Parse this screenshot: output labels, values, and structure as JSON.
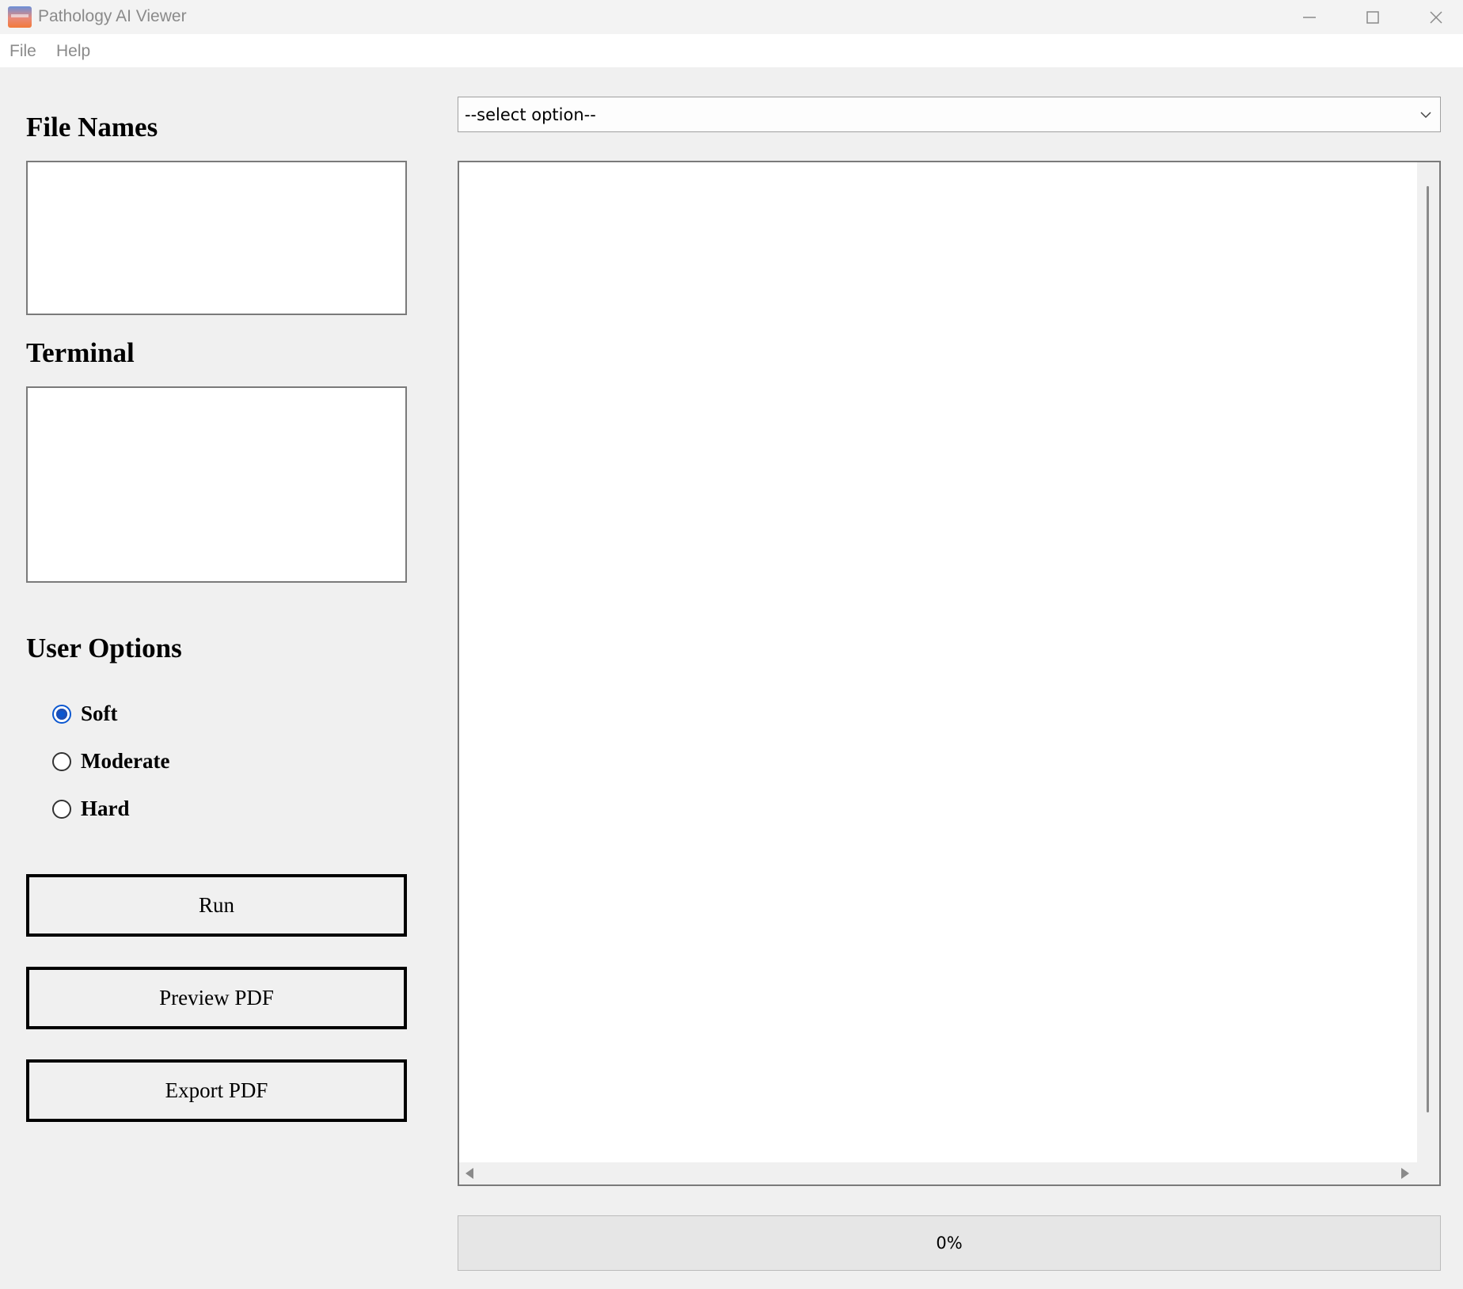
{
  "window": {
    "title": "Pathology AI Viewer",
    "icon": "app-logo-icon",
    "controls": [
      "minimize-icon",
      "maximize-icon",
      "close-icon"
    ]
  },
  "menu": {
    "file": "File",
    "help": "Help"
  },
  "left_panel": {
    "file_names_heading": "File Names",
    "terminal_heading": "Terminal",
    "user_options_heading": "User Options",
    "options": [
      {
        "label": "Soft",
        "checked": true
      },
      {
        "label": "Moderate",
        "checked": false
      },
      {
        "label": "Hard",
        "checked": false
      }
    ],
    "buttons": {
      "run": "Run",
      "preview": "Preview PDF",
      "export": "Export PDF"
    }
  },
  "right_panel": {
    "select": {
      "value": "--select option--"
    },
    "progress": {
      "text": "0%",
      "value": 0
    }
  },
  "colors": {
    "accent": "#0b57d0",
    "background": "#f0f0f0",
    "progress_fill": "#06b025"
  }
}
